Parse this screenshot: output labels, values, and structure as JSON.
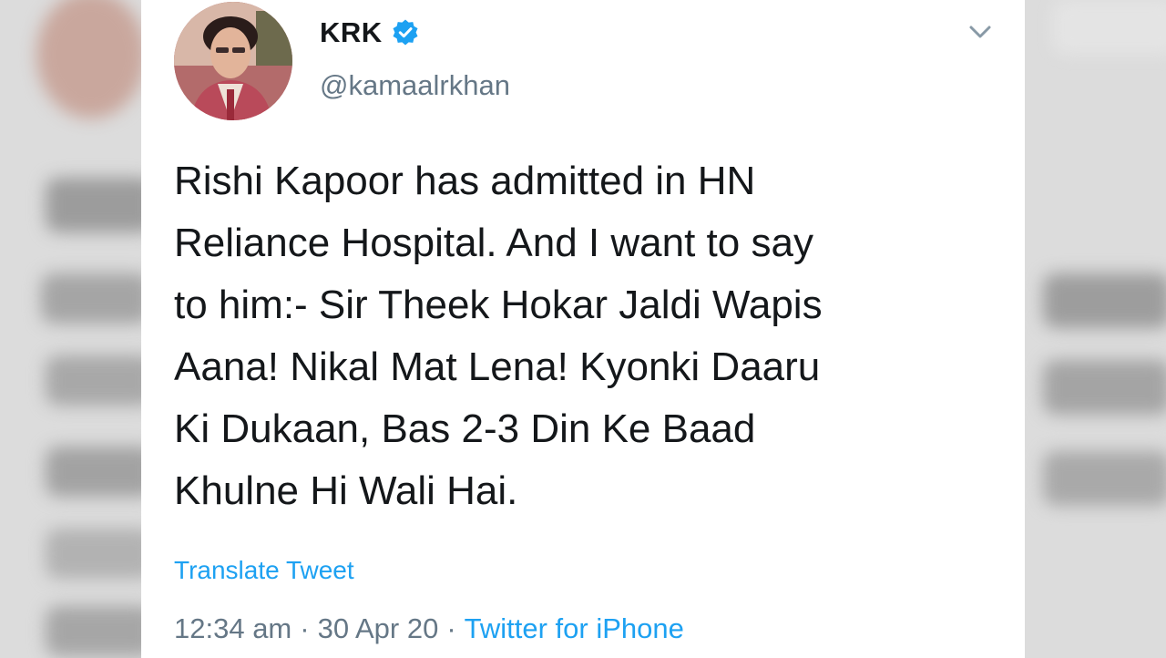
{
  "tweet": {
    "display_name": "KRK",
    "verified": true,
    "handle": "@kamaalrkhan",
    "text": "Rishi Kapoor has admitted in HN\nReliance Hospital. And I want to say\nto him:- Sir Theek Hokar Jaldi Wapis\nAana! Nikal Mat Lena! Kyonki Daaru\nKi Dukaan, Bas 2-3 Din Ke Baad\nKhulne Hi Wali Hai.",
    "translate_label": "Translate Tweet",
    "time": "12:34 am",
    "separator": "·",
    "date": "30 Apr 20",
    "source": "Twitter for iPhone"
  },
  "icons": {
    "verified": "verified-badge-icon",
    "menu": "chevron-down-icon"
  },
  "colors": {
    "link_blue": "#1da1f2",
    "text_primary": "#14171a",
    "text_secondary": "#657786",
    "card_background": "#ffffff"
  }
}
